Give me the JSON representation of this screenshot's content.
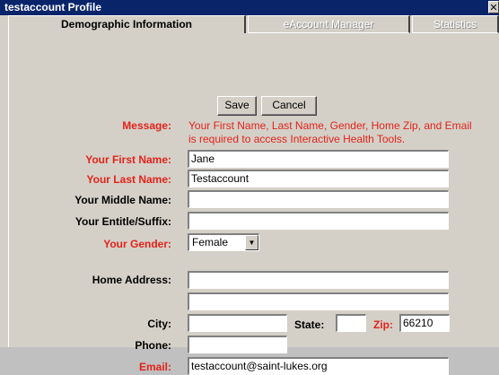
{
  "window": {
    "title": "testaccount Profile",
    "close_glyph": "✕"
  },
  "tabs": [
    {
      "label": "Demographic Information",
      "active": true
    },
    {
      "label": "eAccount Manager",
      "active": false
    },
    {
      "label": "Statistics",
      "active": false
    }
  ],
  "actions": {
    "save_label": "Save",
    "cancel_label": "Cancel"
  },
  "message": {
    "label": "Message:",
    "text": "Your First Name, Last Name, Gender, Home Zip, and Email is required to access Interactive Health Tools."
  },
  "form": {
    "first_name": {
      "label": "Your First Name:",
      "value": "Jane"
    },
    "last_name": {
      "label": "Your Last Name:",
      "value": "Testaccount"
    },
    "middle_name": {
      "label": "Your Middle Name:",
      "value": ""
    },
    "suffix": {
      "label": "Your Entitle/Suffix:",
      "value": ""
    },
    "gender": {
      "label": "Your Gender:",
      "value": "Female"
    },
    "home_address": {
      "label": "Home Address:",
      "line1": "",
      "line2": ""
    },
    "city": {
      "label": "City:",
      "value": ""
    },
    "state": {
      "label": "State:",
      "value": ""
    },
    "zip": {
      "label": "Zip:",
      "value": "66210"
    },
    "phone": {
      "label": "Phone:",
      "value": ""
    },
    "email": {
      "label": "Email:",
      "value": "testaccount@saint-lukes.org"
    }
  },
  "colors": {
    "required": "#e2231a",
    "titlebar": "#0a246a",
    "panel": "#d4d0c8"
  }
}
